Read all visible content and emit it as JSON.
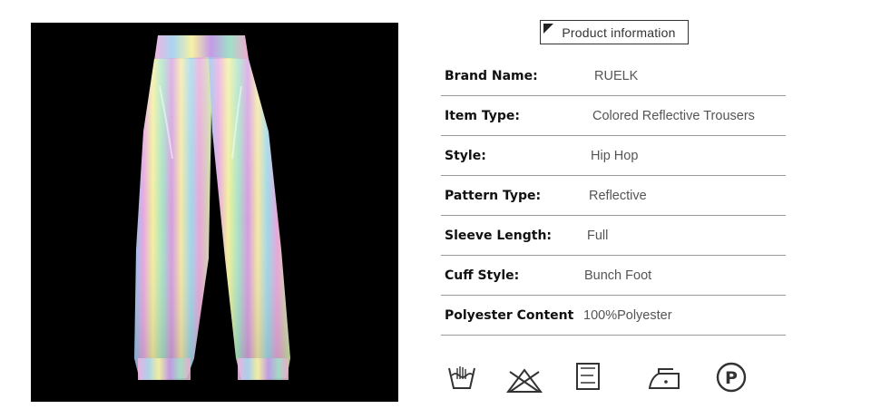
{
  "product_info_title": "Product information",
  "specs": [
    {
      "label": "Brand Name:",
      "value": "RUELK"
    },
    {
      "label": "Item Type:",
      "value": "Colored Reflective Trousers"
    },
    {
      "label": "Style:",
      "value": "Hip Hop"
    },
    {
      "label": "Pattern Type:",
      "value": "Reflective"
    },
    {
      "label": "Sleeve Length:",
      "value": "Full"
    },
    {
      "label": "Cuff Style:",
      "value": "Bunch Foot"
    },
    {
      "label": "Polyester Content",
      "value": "100%Polyester"
    }
  ],
  "care_icons": [
    "hand-wash-icon",
    "do-not-bleach-icon",
    "dry-flat-icon",
    "iron-low-icon",
    "dry-clean-p-icon"
  ],
  "care_icon_glyph_p": "P",
  "colors": {
    "photo_background": "#000000",
    "divider": "#9a9a9a"
  }
}
